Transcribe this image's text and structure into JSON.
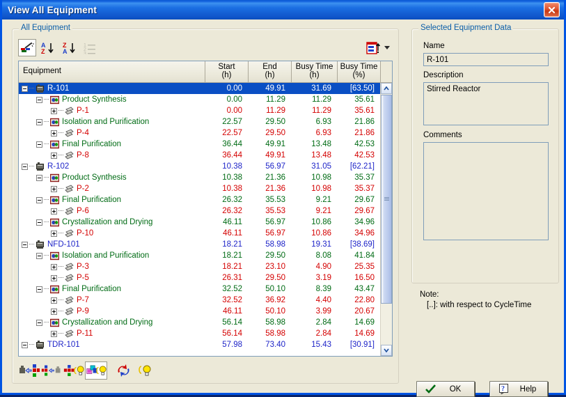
{
  "window": {
    "title": "View All Equipment",
    "close_icon": "close-icon"
  },
  "all_equipment": {
    "group_label": "All Equipment",
    "toolbar": [
      {
        "name": "filter-wand-icon",
        "label": "Filter"
      },
      {
        "name": "sort-ascending-icon",
        "label": "Sort A-Z"
      },
      {
        "name": "sort-descending-icon",
        "label": "Sort Z-A"
      },
      {
        "name": "numbered-list-icon",
        "label": "Number List"
      },
      {
        "name": "export-icon",
        "label": "Export"
      },
      {
        "name": "chevron-down-icon",
        "label": "More"
      }
    ],
    "columns": [
      {
        "line1": "Equipment",
        "line2": ""
      },
      {
        "line1": "Start",
        "line2": "(h)"
      },
      {
        "line1": "End",
        "line2": "(h)"
      },
      {
        "line1": "Busy Time",
        "line2": "(h)"
      },
      {
        "line1": "Busy Time",
        "line2": "(%)"
      }
    ],
    "rows": [
      {
        "level": 0,
        "expander": "minus",
        "icon": "equipment-icon",
        "label": "R-101",
        "start": "0.00",
        "end": "49.91",
        "busy_h": "31.69",
        "busy_pct": "[63.50]",
        "selected": true
      },
      {
        "level": 1,
        "expander": "minus",
        "icon": "operation-icon",
        "label": "Product Synthesis",
        "start": "0.00",
        "end": "11.29",
        "busy_h": "11.29",
        "busy_pct": "35.61",
        "selected": false
      },
      {
        "level": 2,
        "expander": "plus",
        "icon": "procedure-icon",
        "label": "P-1",
        "start": "0.00",
        "end": "11.29",
        "busy_h": "11.29",
        "busy_pct": "35.61",
        "selected": false
      },
      {
        "level": 1,
        "expander": "minus",
        "icon": "operation-icon",
        "label": "Isolation and Purification",
        "start": "22.57",
        "end": "29.50",
        "busy_h": "6.93",
        "busy_pct": "21.86",
        "selected": false
      },
      {
        "level": 2,
        "expander": "plus",
        "icon": "procedure-icon",
        "label": "P-4",
        "start": "22.57",
        "end": "29.50",
        "busy_h": "6.93",
        "busy_pct": "21.86",
        "selected": false
      },
      {
        "level": 1,
        "expander": "minus",
        "icon": "operation-icon",
        "label": "Final Purification",
        "start": "36.44",
        "end": "49.91",
        "busy_h": "13.48",
        "busy_pct": "42.53",
        "selected": false
      },
      {
        "level": 2,
        "expander": "plus",
        "icon": "procedure-icon",
        "label": "P-8",
        "start": "36.44",
        "end": "49.91",
        "busy_h": "13.48",
        "busy_pct": "42.53",
        "selected": false
      },
      {
        "level": 0,
        "expander": "minus",
        "icon": "equipment-icon",
        "label": "R-102",
        "start": "10.38",
        "end": "56.97",
        "busy_h": "31.05",
        "busy_pct": "[62.21]",
        "selected": false
      },
      {
        "level": 1,
        "expander": "minus",
        "icon": "operation-icon",
        "label": "Product Synthesis",
        "start": "10.38",
        "end": "21.36",
        "busy_h": "10.98",
        "busy_pct": "35.37",
        "selected": false
      },
      {
        "level": 2,
        "expander": "plus",
        "icon": "procedure-icon",
        "label": "P-2",
        "start": "10.38",
        "end": "21.36",
        "busy_h": "10.98",
        "busy_pct": "35.37",
        "selected": false
      },
      {
        "level": 1,
        "expander": "minus",
        "icon": "operation-icon",
        "label": "Final Purification",
        "start": "26.32",
        "end": "35.53",
        "busy_h": "9.21",
        "busy_pct": "29.67",
        "selected": false
      },
      {
        "level": 2,
        "expander": "plus",
        "icon": "procedure-icon",
        "label": "P-6",
        "start": "26.32",
        "end": "35.53",
        "busy_h": "9.21",
        "busy_pct": "29.67",
        "selected": false
      },
      {
        "level": 1,
        "expander": "minus",
        "icon": "operation-icon",
        "label": "Crystallization and Drying",
        "start": "46.11",
        "end": "56.97",
        "busy_h": "10.86",
        "busy_pct": "34.96",
        "selected": false
      },
      {
        "level": 2,
        "expander": "plus",
        "icon": "procedure-icon",
        "label": "P-10",
        "start": "46.11",
        "end": "56.97",
        "busy_h": "10.86",
        "busy_pct": "34.96",
        "selected": false
      },
      {
        "level": 0,
        "expander": "minus",
        "icon": "equipment-icon",
        "label": "NFD-101",
        "start": "18.21",
        "end": "58.98",
        "busy_h": "19.31",
        "busy_pct": "[38.69]",
        "selected": false
      },
      {
        "level": 1,
        "expander": "minus",
        "icon": "operation-icon",
        "label": "Isolation and Purification",
        "start": "18.21",
        "end": "29.50",
        "busy_h": "8.08",
        "busy_pct": "41.84",
        "selected": false
      },
      {
        "level": 2,
        "expander": "plus",
        "icon": "procedure-icon",
        "label": "P-3",
        "start": "18.21",
        "end": "23.10",
        "busy_h": "4.90",
        "busy_pct": "25.35",
        "selected": false
      },
      {
        "level": 2,
        "expander": "plus",
        "icon": "procedure-icon",
        "label": "P-5",
        "start": "26.31",
        "end": "29.50",
        "busy_h": "3.19",
        "busy_pct": "16.50",
        "selected": false
      },
      {
        "level": 1,
        "expander": "minus",
        "icon": "operation-icon",
        "label": "Final Purification",
        "start": "32.52",
        "end": "50.10",
        "busy_h": "8.39",
        "busy_pct": "43.47",
        "selected": false
      },
      {
        "level": 2,
        "expander": "plus",
        "icon": "procedure-icon",
        "label": "P-7",
        "start": "32.52",
        "end": "36.92",
        "busy_h": "4.40",
        "busy_pct": "22.80",
        "selected": false
      },
      {
        "level": 2,
        "expander": "plus",
        "icon": "procedure-icon",
        "label": "P-9",
        "start": "46.11",
        "end": "50.10",
        "busy_h": "3.99",
        "busy_pct": "20.67",
        "selected": false
      },
      {
        "level": 1,
        "expander": "minus",
        "icon": "operation-icon",
        "label": "Crystallization and Drying",
        "start": "56.14",
        "end": "58.98",
        "busy_h": "2.84",
        "busy_pct": "14.69",
        "selected": false
      },
      {
        "level": 2,
        "expander": "plus",
        "icon": "procedure-icon",
        "label": "P-11",
        "start": "56.14",
        "end": "58.98",
        "busy_h": "2.84",
        "busy_pct": "14.69",
        "selected": false
      },
      {
        "level": 0,
        "expander": "minus",
        "icon": "equipment-icon",
        "label": "TDR-101",
        "start": "57.98",
        "end": "73.40",
        "busy_h": "15.43",
        "busy_pct": "[30.91]",
        "selected": false
      }
    ],
    "bottom_toolbar": [
      {
        "name": "equipment-to-operation-icon",
        "label": "Equipment to Operation"
      },
      {
        "name": "operation-to-equipment-icon",
        "label": "Operation to Equipment"
      },
      {
        "name": "operation-highlight-icon",
        "label": "Highlight Operations"
      },
      {
        "name": "procedure-highlight-icon",
        "label": "Highlight Procedures"
      },
      {
        "name": "refresh-icon",
        "label": "Refresh"
      },
      {
        "name": "bulb-icon",
        "label": "Highlight"
      }
    ]
  },
  "selected_equipment": {
    "group_label": "Selected Equipment Data",
    "name_label": "Name",
    "name_value": "R-101",
    "description_label": "Description",
    "description_value": "Stirred Reactor",
    "comments_label": "Comments",
    "comments_value": ""
  },
  "note": {
    "line1": "Note:",
    "line2": "[..]: with respect to CycleTime"
  },
  "buttons": {
    "ok": "OK",
    "help": "Help"
  },
  "colors": {
    "title_bar": "#0a59d4",
    "level0_text": "#1e24c8",
    "level1_text": "#006b14",
    "level2_text": "#d40000",
    "selection": "#0a4fc4",
    "dialog_bg": "#ece9d8",
    "group_label": "#0b5ea8"
  }
}
